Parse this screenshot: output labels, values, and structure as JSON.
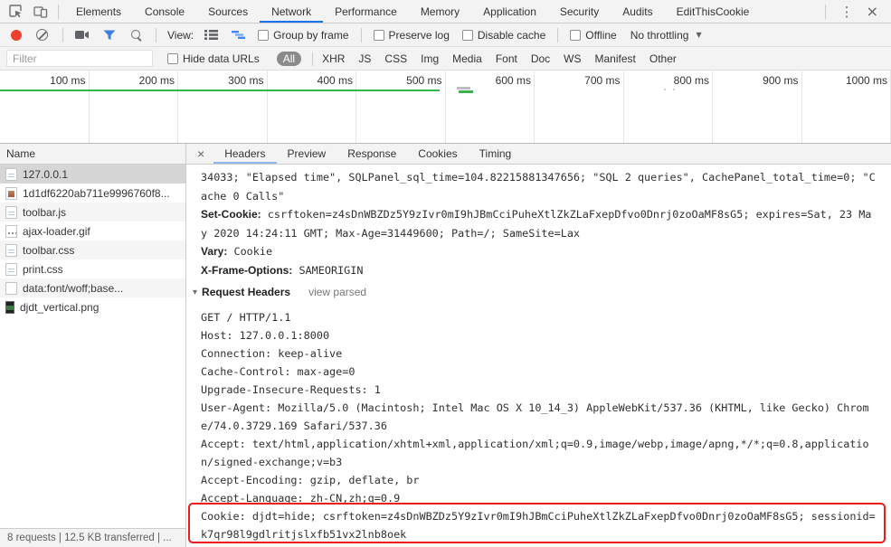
{
  "window": {
    "tabs": [
      {
        "label": "Elements"
      },
      {
        "label": "Console"
      },
      {
        "label": "Sources"
      },
      {
        "label": "Network",
        "active": true
      },
      {
        "label": "Performance"
      },
      {
        "label": "Memory"
      },
      {
        "label": "Application"
      },
      {
        "label": "Security"
      },
      {
        "label": "Audits"
      },
      {
        "label": "EditThisCookie"
      }
    ],
    "menu_icon": "⋮",
    "close_icon": "×"
  },
  "network_toolbar": {
    "view_label": "View:",
    "group_by_frame": "Group by frame",
    "preserve_log": "Preserve log",
    "disable_cache": "Disable cache",
    "offline": "Offline",
    "throttling": "No throttling",
    "throttling_caret": "▼"
  },
  "filter_bar": {
    "placeholder": "Filter",
    "hide_data_urls": "Hide data URLs",
    "types": [
      {
        "label": "All",
        "active": true
      },
      {
        "label": "XHR"
      },
      {
        "label": "JS"
      },
      {
        "label": "CSS"
      },
      {
        "label": "Img"
      },
      {
        "label": "Media"
      },
      {
        "label": "Font"
      },
      {
        "label": "Doc"
      },
      {
        "label": "WS"
      },
      {
        "label": "Manifest"
      },
      {
        "label": "Other"
      }
    ]
  },
  "overview": {
    "ticks": [
      "100 ms",
      "200 ms",
      "300 ms",
      "400 ms",
      "500 ms",
      "600 ms",
      "700 ms",
      "800 ms",
      "900 ms",
      "1000 ms"
    ]
  },
  "requests": {
    "name_header": "Name",
    "close_icon": "×",
    "rows": [
      {
        "name": "127.0.0.1",
        "icon": "doc",
        "selected": true
      },
      {
        "name": "1d1df6220ab711e9996760f8...",
        "icon": "img"
      },
      {
        "name": "toolbar.js",
        "icon": "doc"
      },
      {
        "name": "ajax-loader.gif",
        "icon": "dots"
      },
      {
        "name": "toolbar.css",
        "icon": "doc"
      },
      {
        "name": "print.css",
        "icon": "doc"
      },
      {
        "name": "data:font/woff;base...",
        "icon": "blank"
      },
      {
        "name": "djdt_vertical.png",
        "icon": "thumb"
      }
    ]
  },
  "details": {
    "tabs": [
      {
        "label": "Headers",
        "active": true
      },
      {
        "label": "Preview"
      },
      {
        "label": "Response"
      },
      {
        "label": "Cookies"
      },
      {
        "label": "Timing"
      }
    ],
    "response_lines": [
      {
        "text": "34033; \"Elapsed time\", SQLPanel_sql_time=104.82215881347656; \"SQL 2 queries\", CachePanel_total_time=0; \"C"
      },
      {
        "text": "ache 0 Calls\""
      },
      {
        "name": "Set-Cookie:",
        "text": " csrftoken=z4sDnWBZDz5Y9zIvr0mI9hJBmCciPuheXtlZkZLaFxepDfvo0Dnrj0zoOaMF8sG5; expires=Sat, 23 Ma"
      },
      {
        "text": "y 2020 14:24:11 GMT; Max-Age=31449600; Path=/; SameSite=Lax"
      },
      {
        "name": "Vary:",
        "text": " Cookie"
      },
      {
        "name": "X-Frame-Options:",
        "text": " SAMEORIGIN"
      }
    ],
    "request_headers_section": {
      "disclosure": "▾",
      "title": "Request Headers",
      "action": "view parsed"
    },
    "request_lines": [
      "GET / HTTP/1.1",
      "Host: 127.0.0.1:8000",
      "Connection: keep-alive",
      "Cache-Control: max-age=0",
      "Upgrade-Insecure-Requests: 1",
      "User-Agent: Mozilla/5.0 (Macintosh; Intel Mac OS X 10_14_3) AppleWebKit/537.36 (KHTML, like Gecko) Chrom",
      "e/74.0.3729.169 Safari/537.36",
      "Accept: text/html,application/xhtml+xml,application/xml;q=0.9,image/webp,image/apng,*/*;q=0.8,applicatio",
      "n/signed-exchange;v=b3",
      "Accept-Encoding: gzip, deflate, br",
      "Accept-Language: zh-CN,zh;q=0.9",
      "Cookie: djdt=hide; csrftoken=z4sDnWBZDz5Y9zIvr0mI9hJBmCciPuheXtlZkZLaFxepDfvo0Dnrj0zoOaMF8sG5; sessionid=",
      "k7qr98l9gdlritjslxfb51vx2lnb8oek"
    ]
  },
  "status_bar": {
    "summary": "8 requests | 12.5 KB transferred | ..."
  },
  "colors": {
    "accent_blue": "#1a73e8",
    "record_red": "#ee402e",
    "timeline_green": "#38b24a",
    "highlight_red": "#ef1b1b",
    "selected_row": "#d6d6d6"
  }
}
